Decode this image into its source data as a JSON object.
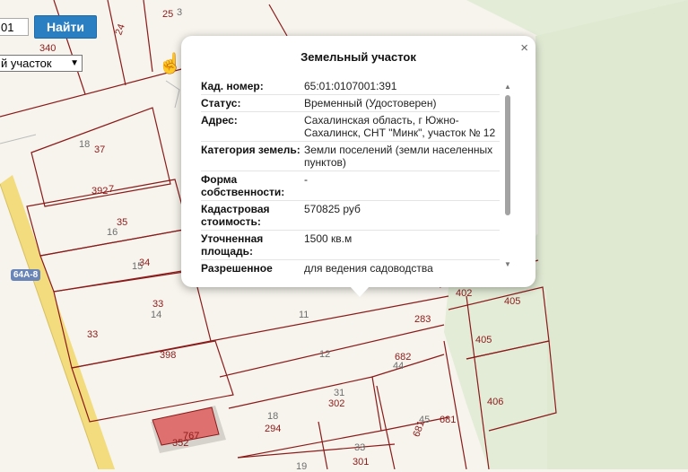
{
  "search": {
    "value": "01",
    "button_label": "Найти",
    "type_selected": "й участок"
  },
  "map": {
    "labels": [
      {
        "t": "25",
        "c": "r"
      },
      {
        "t": "3",
        "c": "g"
      },
      {
        "t": "340",
        "c": "r"
      },
      {
        "t": "24",
        "c": "r"
      },
      {
        "t": "18",
        "c": "g"
      },
      {
        "t": "37",
        "c": "r"
      },
      {
        "t": "392",
        "c": "r"
      },
      {
        "t": "7",
        "c": "r"
      },
      {
        "t": "35",
        "c": "r"
      },
      {
        "t": "16",
        "c": "g"
      },
      {
        "t": "15",
        "c": "g"
      },
      {
        "t": "34",
        "c": "r"
      },
      {
        "t": "33",
        "c": "r"
      },
      {
        "t": "14",
        "c": "g"
      },
      {
        "t": "33",
        "c": "r"
      },
      {
        "t": "398",
        "c": "r"
      },
      {
        "t": "11",
        "c": "g"
      },
      {
        "t": "283",
        "c": "r"
      },
      {
        "t": "12",
        "c": "g"
      },
      {
        "t": "402",
        "c": "r"
      },
      {
        "t": "405",
        "c": "r"
      },
      {
        "t": "405",
        "c": "r"
      },
      {
        "t": "682",
        "c": "r"
      },
      {
        "t": "44",
        "c": "g"
      },
      {
        "t": "31",
        "c": "g"
      },
      {
        "t": "302",
        "c": "r"
      },
      {
        "t": "406",
        "c": "r"
      },
      {
        "t": "18",
        "c": "g"
      },
      {
        "t": "294",
        "c": "r"
      },
      {
        "t": "45",
        "c": "g"
      },
      {
        "t": "681",
        "c": "r"
      },
      {
        "t": "681",
        "c": "r"
      },
      {
        "t": "767",
        "c": "r"
      },
      {
        "t": "352",
        "c": "r"
      },
      {
        "t": "33",
        "c": "g"
      },
      {
        "t": "301",
        "c": "r"
      },
      {
        "t": "19",
        "c": "g"
      }
    ],
    "road_label": "64А-8"
  },
  "popup": {
    "title": "Земельный участок",
    "close_symbol": "×",
    "rows": [
      {
        "key": "Кад. номер:",
        "value": "65:01:0107001:391"
      },
      {
        "key": "Статус:",
        "value": "Временный (Удостоверен)"
      },
      {
        "key": "Адрес:",
        "value": "Сахалинская область, г Южно-Сахалинск, СНТ \"Минк\", участок № 12"
      },
      {
        "key": "Категория земель:",
        "value": "Земли поселений (земли населенных пунктов)"
      },
      {
        "key": "Форма собственности:",
        "value": "-"
      },
      {
        "key": "Кадастровая стоимость:",
        "value": "570825 руб"
      },
      {
        "key": "Уточненная площадь:",
        "value": "1500 кв.м"
      },
      {
        "key": "Разрешенное",
        "value": "для ведения садоводства"
      }
    ]
  },
  "colors": {
    "button": "#2a7fc3",
    "parcel_line": "#8b1a1a",
    "green": "#e6eedc",
    "highlight": "#e0706e"
  }
}
